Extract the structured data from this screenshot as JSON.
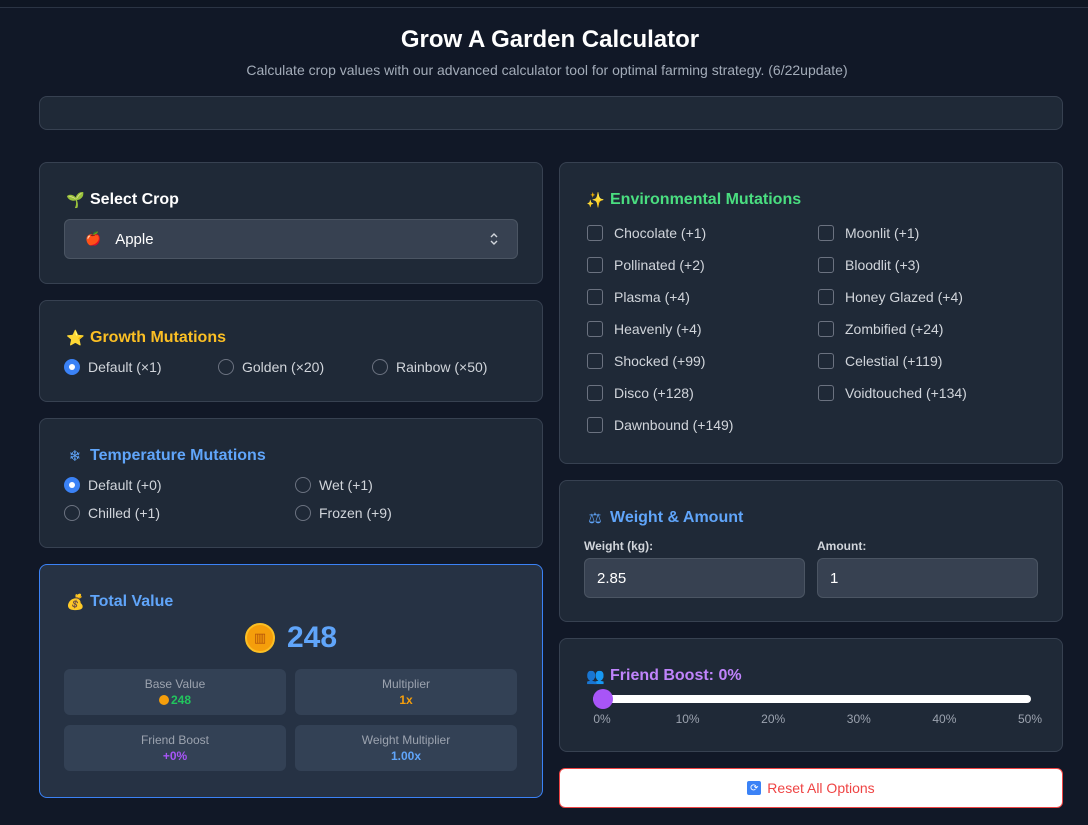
{
  "header": {
    "title": "Grow A Garden Calculator",
    "subtitle": "Calculate crop values with our advanced calculator tool for optimal farming strategy.  (6/22update)"
  },
  "select_crop": {
    "title": "Select Crop",
    "icon": "seedling-icon",
    "selected": "Apple",
    "selected_icon": "apple-icon"
  },
  "growth": {
    "title": "Growth Mutations",
    "icon": "star-icon",
    "color": "#fbbf24",
    "options": [
      {
        "label": "Default (×1)",
        "checked": true
      },
      {
        "label": "Golden (×20)",
        "checked": false
      },
      {
        "label": "Rainbow (×50)",
        "checked": false
      }
    ]
  },
  "temperature": {
    "title": "Temperature Mutations",
    "icon": "snowflake-icon",
    "color": "#60a5fa",
    "options": [
      {
        "label": "Default (+0)",
        "checked": true
      },
      {
        "label": "Wet (+1)",
        "checked": false
      },
      {
        "label": "Chilled (+1)",
        "checked": false
      },
      {
        "label": "Frozen (+9)",
        "checked": false
      }
    ]
  },
  "total": {
    "title": "Total Value",
    "icon": "money-bag-icon",
    "value": "248",
    "stats": [
      {
        "label": "Base Value",
        "value": "248",
        "color": "#22c55e"
      },
      {
        "label": "Multiplier",
        "value": "1x",
        "color": "#f59e0b"
      },
      {
        "label": "Friend Boost",
        "value": "+0%",
        "color": "#a855f7"
      },
      {
        "label": "Weight Multiplier",
        "value": "1.00x",
        "color": "#60a5fa"
      }
    ]
  },
  "environmental": {
    "title": "Environmental Mutations",
    "icon": "sparkles-icon",
    "color": "#4ade80",
    "options": [
      "Chocolate (+1)",
      "Moonlit (+1)",
      "Pollinated (+2)",
      "Bloodlit (+3)",
      "Plasma (+4)",
      "Honey Glazed (+4)",
      "Heavenly (+4)",
      "Zombified (+24)",
      "Shocked (+99)",
      "Celestial (+119)",
      "Disco (+128)",
      "Voidtouched (+134)",
      "Dawnbound (+149)"
    ]
  },
  "weight": {
    "title": "Weight & Amount",
    "icon": "scales-icon",
    "weight_label": "Weight (kg):",
    "weight_value": "2.85",
    "amount_label": "Amount:",
    "amount_value": "1"
  },
  "friend": {
    "title": "Friend Boost: 0%",
    "icon": "people-icon",
    "color": "#c084fc",
    "value_percent": 0,
    "ticks": [
      "0%",
      "10%",
      "20%",
      "30%",
      "40%",
      "50%"
    ]
  },
  "reset": {
    "label": "Reset All Options",
    "icon": "refresh-icon"
  }
}
